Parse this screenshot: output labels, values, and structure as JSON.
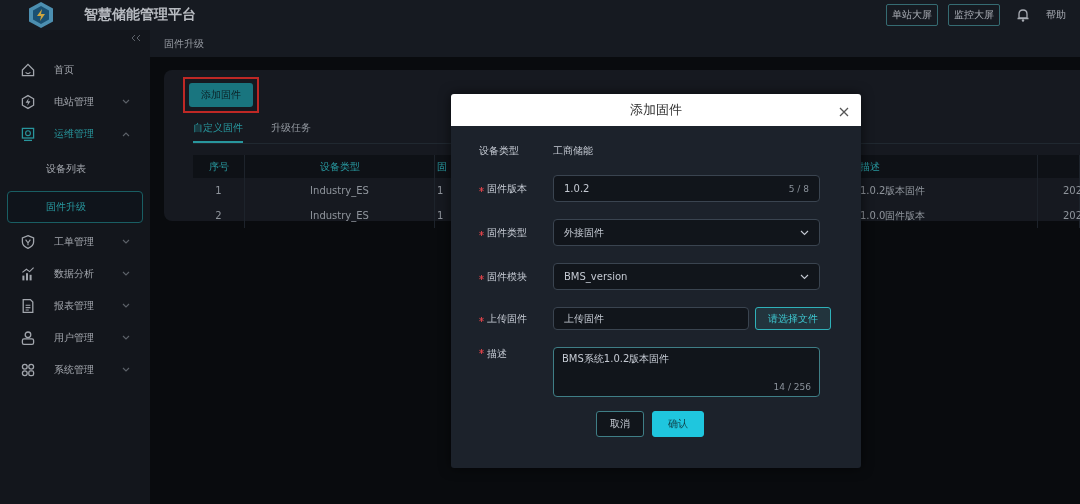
{
  "header": {
    "title": "智慧储能管理平台",
    "buttons": [
      "单站大屏",
      "监控大屏"
    ],
    "help": "帮助"
  },
  "sidebar": {
    "items": [
      {
        "label": "首页",
        "selected": false
      },
      {
        "label": "电站管理",
        "expanded": false,
        "selected": false
      },
      {
        "label": "运维管理",
        "expanded": true,
        "selected": true,
        "children": [
          {
            "label": "设备列表",
            "selected": false
          },
          {
            "label": "固件升级",
            "selected": true
          }
        ]
      },
      {
        "label": "工单管理",
        "expanded": false,
        "selected": false
      },
      {
        "label": "数据分析",
        "expanded": false,
        "selected": false
      },
      {
        "label": "报表管理",
        "expanded": false,
        "selected": false
      },
      {
        "label": "用户管理",
        "expanded": false,
        "selected": false
      },
      {
        "label": "系统管理",
        "expanded": false,
        "selected": false
      }
    ]
  },
  "breadcrumb": "固件升级",
  "add_button": {
    "label": "添加固件",
    "highlighted": true
  },
  "tabs": [
    {
      "label": "自定义固件",
      "selected": true
    },
    {
      "label": "升级任务",
      "selected": false
    }
  ],
  "table": {
    "columns": [
      "序号",
      "设备类型",
      "固",
      "描述"
    ],
    "rows": [
      [
        "1",
        "Industry_ES",
        "1",
        "1.0.2版本固件",
        "202"
      ],
      [
        "2",
        "Industry_ES",
        "1",
        "1.0.0固件版本",
        "202"
      ]
    ]
  },
  "dialog": {
    "title": "添加固件",
    "fields": [
      {
        "kind": "static",
        "label": "设备类型",
        "value": "工商储能"
      },
      {
        "kind": "input",
        "label": "固件版本",
        "value": "1.0.2",
        "counter": "5 / 8",
        "required": true
      },
      {
        "kind": "select",
        "label": "固件类型",
        "value": "外接固件",
        "required": true
      },
      {
        "kind": "select",
        "label": "固件模块",
        "value": "BMS_version",
        "required": true
      },
      {
        "kind": "file",
        "label": "上传固件",
        "value": "上传固件",
        "button": "请选择文件",
        "required": true
      },
      {
        "kind": "textarea",
        "label": "描述",
        "value": "BMS系统1.0.2版本固件",
        "counter": "14 / 256",
        "required": true
      }
    ],
    "buttons": [
      {
        "label": "取消",
        "kind": "secondary"
      },
      {
        "label": "确认",
        "kind": "primary"
      }
    ]
  }
}
